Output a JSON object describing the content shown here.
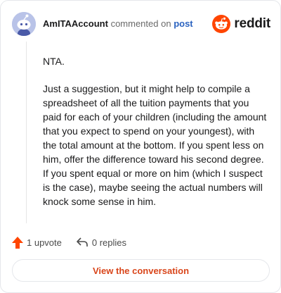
{
  "comment": {
    "username": "AmITAAccount",
    "verb": "commented on",
    "link_text": "post",
    "paragraphs": [
      "NTA.",
      "Just a suggestion, but it might help to compile a spreadsheet of all the tuition payments that you paid for each of your children (including the amount that you expect to spend on your youngest), with the total amount at the bottom. If you spent less on him, offer the difference toward his second degree. If you spent equal or more on him (which I suspect is the case), maybe seeing the actual numbers will knock some sense in him."
    ]
  },
  "brand": {
    "name": "reddit",
    "color": "#ff4500"
  },
  "actions": {
    "upvotes": "1 upvote",
    "replies": "0 replies"
  },
  "cta": {
    "label": "View the conversation"
  },
  "colors": {
    "accent": "#d9461b",
    "link": "#2b63c0",
    "upvote": "#ff4500"
  },
  "icons": [
    "avatar-snoo-icon",
    "reddit-logo-icon",
    "upvote-arrow-icon",
    "reply-icon"
  ]
}
